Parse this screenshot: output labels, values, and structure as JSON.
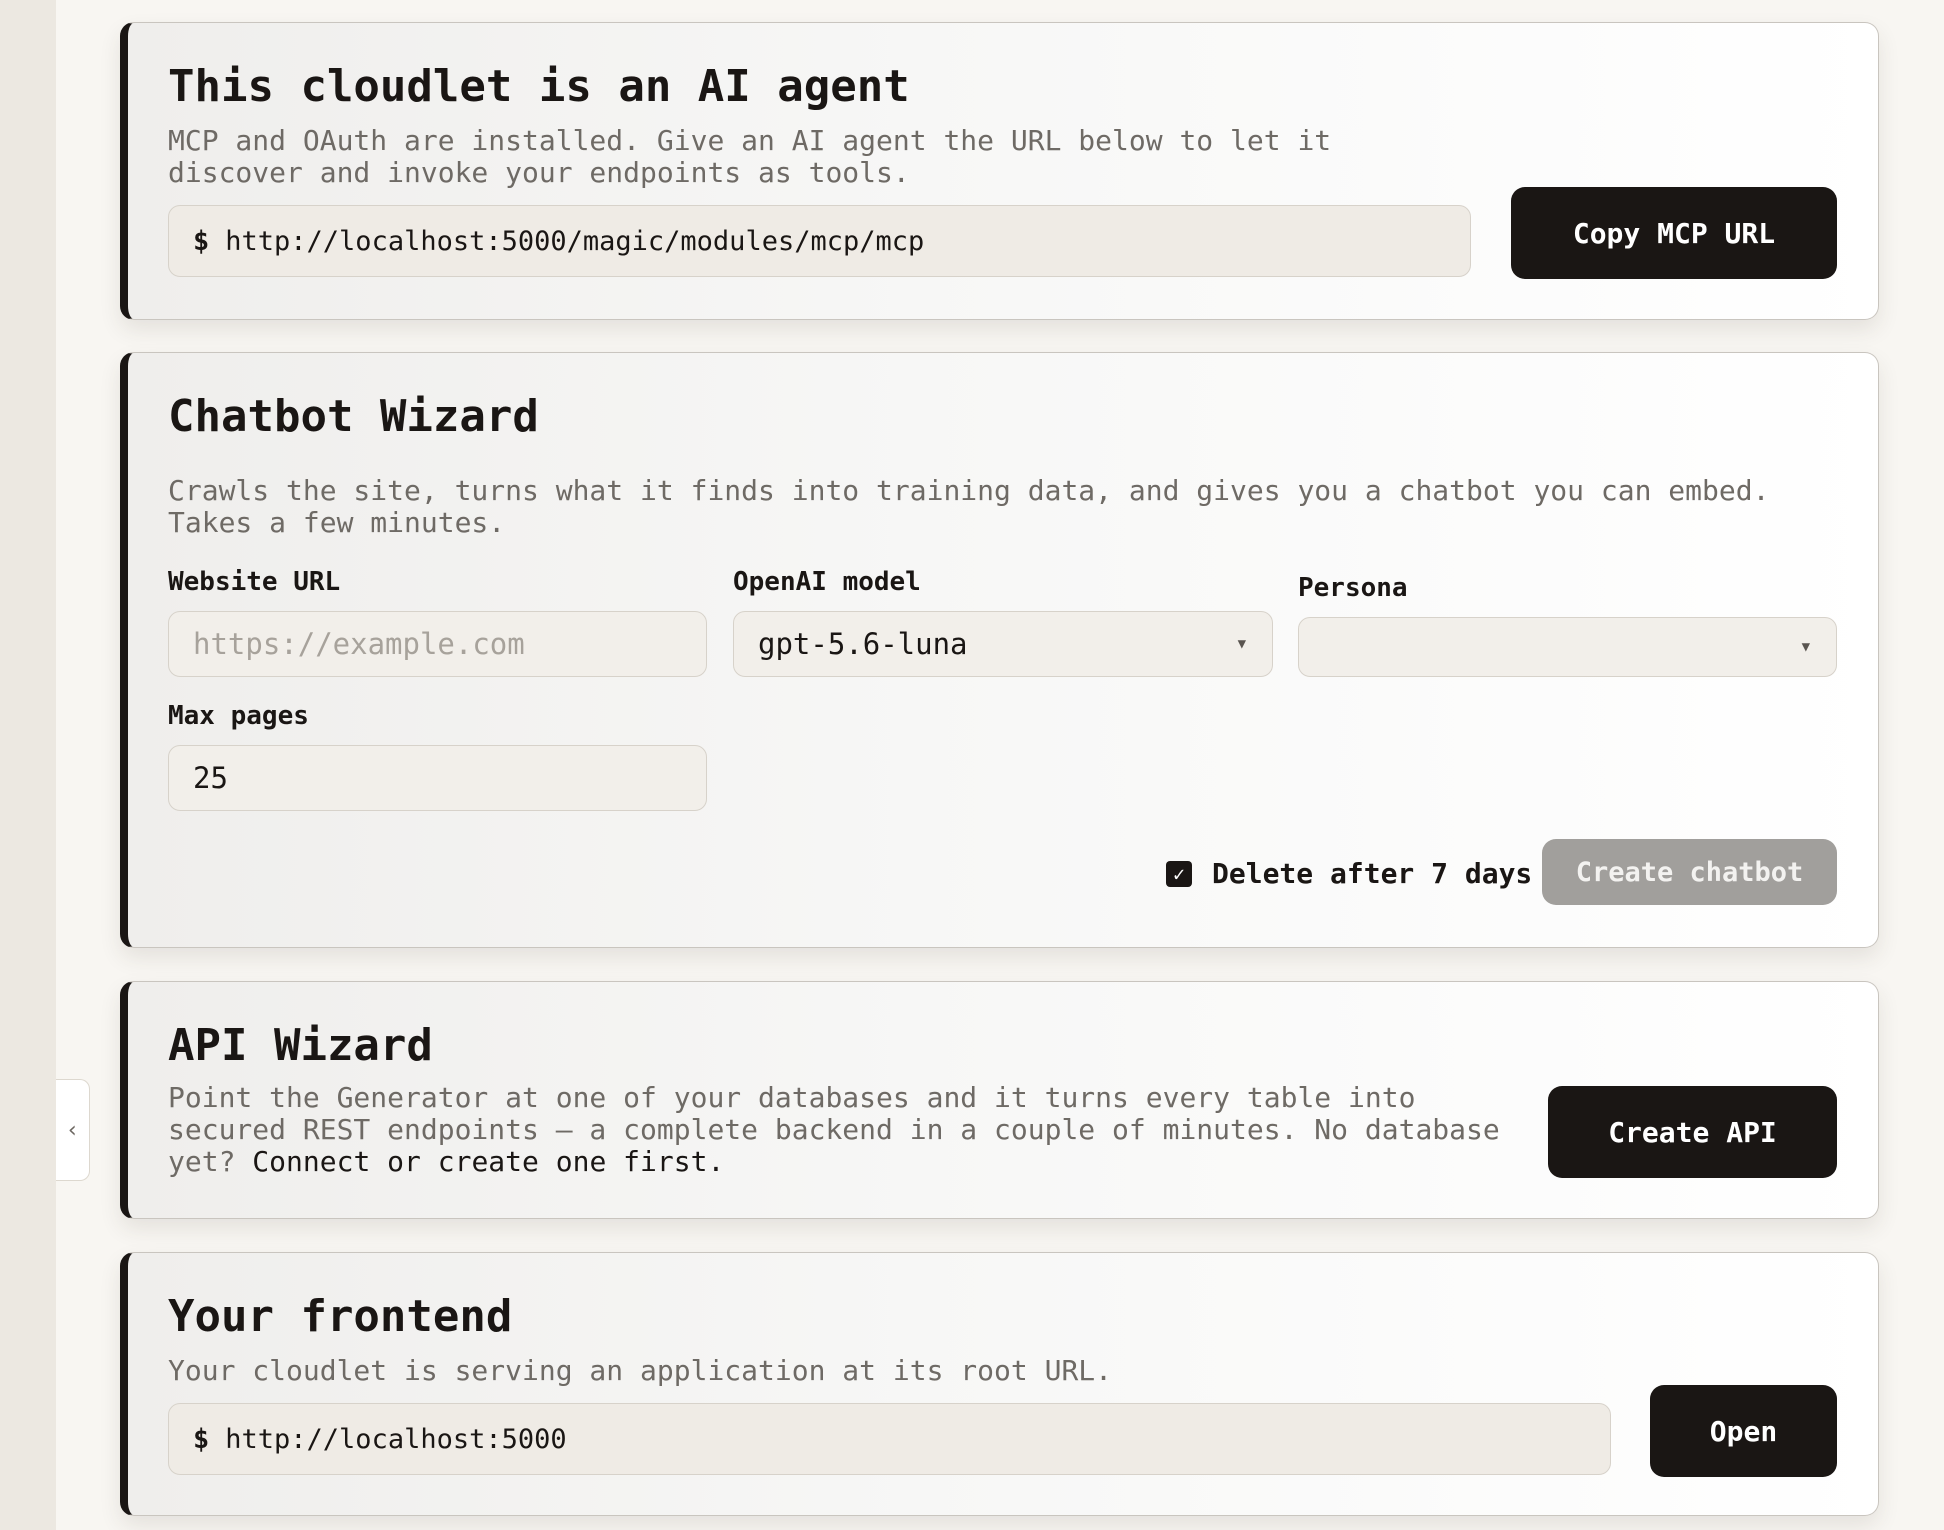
{
  "mcp_card": {
    "title": "This cloudlet is an AI agent",
    "description": "MCP and OAuth are installed. Give an AI agent the URL below to let it discover and invoke your endpoints as tools.",
    "prompt": "$",
    "url": "http://localhost:5000/magic/modules/mcp/mcp",
    "button_label": "Copy MCP URL"
  },
  "chatbot_card": {
    "title": "Chatbot Wizard",
    "description": "Crawls the site, turns what it finds into training data, and gives you a chatbot you can embed. Takes a few minutes.",
    "website_url": {
      "label": "Website URL",
      "value": "",
      "placeholder": "https://example.com"
    },
    "model": {
      "label": "OpenAI model",
      "value": "gpt-5.6-luna"
    },
    "persona": {
      "label": "Persona",
      "value": ""
    },
    "max_pages": {
      "label": "Max pages",
      "value": "25"
    },
    "delete_after": {
      "label": "Delete after 7 days",
      "checked": true
    },
    "button_label": "Create chatbot"
  },
  "api_card": {
    "title": "API Wizard",
    "description": "Point the Generator at one of your databases and it turns every table into secured REST endpoints — a complete backend in a couple of minutes. No database yet?",
    "link_text": "Connect or create one first.",
    "button_label": "Create API"
  },
  "frontend_card": {
    "title": "Your frontend",
    "description": "Your cloudlet is serving an application at its root URL.",
    "prompt": "$",
    "url": "http://localhost:5000",
    "button_label": "Open"
  },
  "icons": {
    "collapse": "chevron-left-icon",
    "select_caret": "caret-down-icon",
    "checkbox": "check-icon"
  },
  "colors": {
    "accent_dark": "#1a1614",
    "disabled_button": "#a19f9c",
    "muted_text": "#6e6a65"
  }
}
